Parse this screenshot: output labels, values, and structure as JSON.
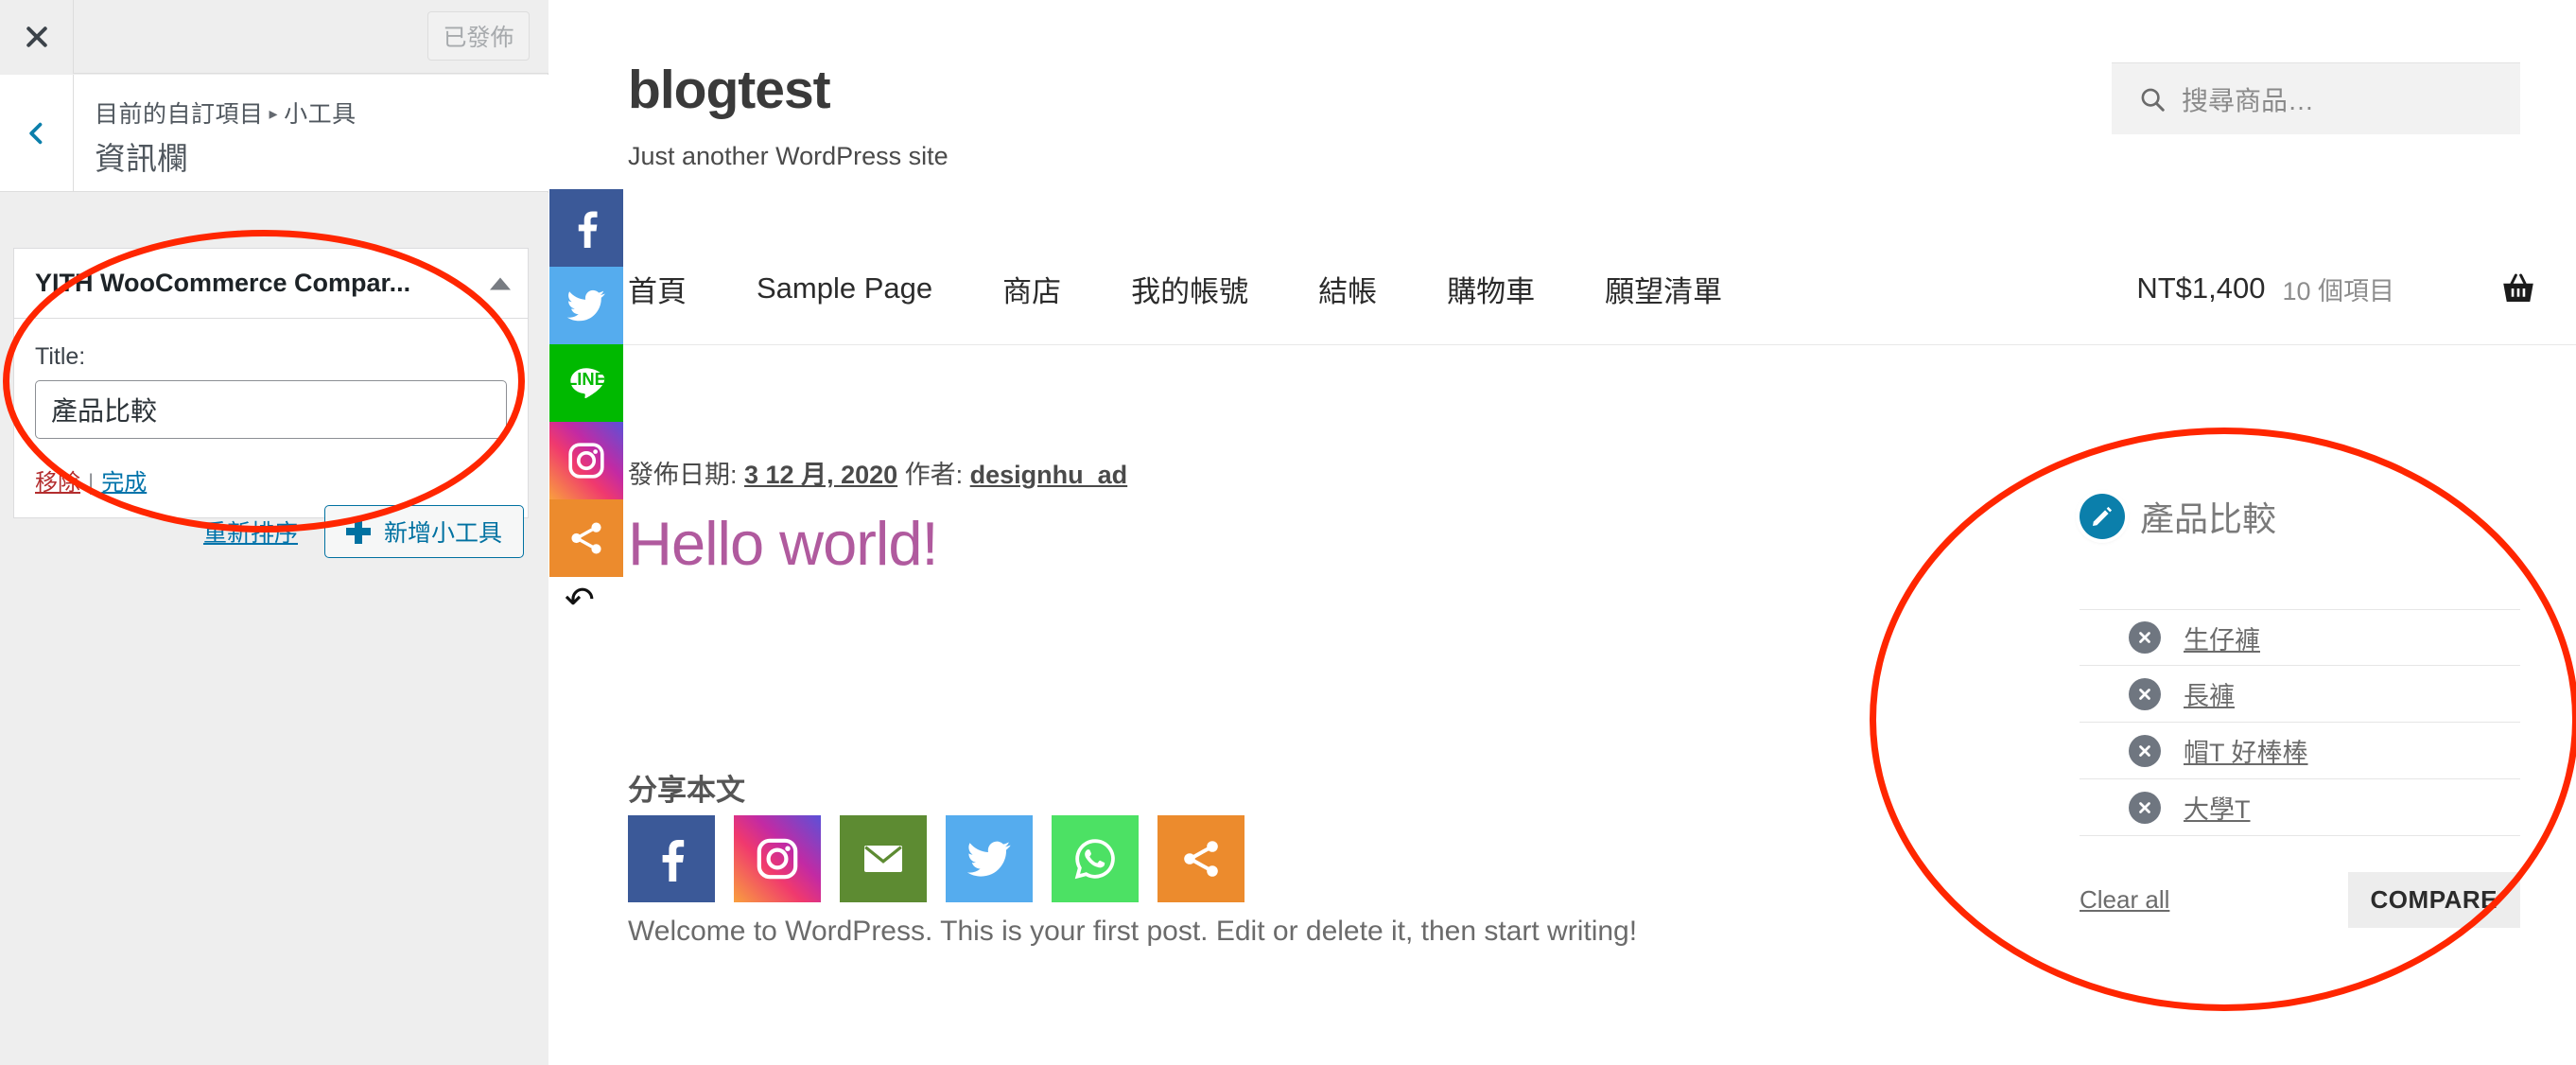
{
  "customizer": {
    "close_icon": "close-icon",
    "publish_label": "已發佈",
    "back_icon": "chevron-left-icon",
    "breadcrumb_parent": "目前的自訂項目",
    "breadcrumb_sep": "▸",
    "breadcrumb_current": "小工具",
    "panel_title": "資訊欄",
    "widget": {
      "name": "YITH WooCommerce Compar...",
      "toggle_icon": "chevron-up-icon",
      "field_label": "Title:",
      "field_value": "產品比較",
      "field_placeholder": "",
      "delete_label": "移除",
      "separator": "|",
      "done_label": "完成"
    },
    "reorder_label": "重新排序",
    "add_widget_label": "新增小工具",
    "add_widget_icon": "plus-icon"
  },
  "site": {
    "title": "blogtest",
    "tagline": "Just another WordPress site",
    "search": {
      "icon": "search-icon",
      "placeholder": "搜尋商品…",
      "value": ""
    },
    "nav": [
      {
        "label": "首頁"
      },
      {
        "label": "Sample Page"
      },
      {
        "label": "商店"
      },
      {
        "label": "我的帳號"
      },
      {
        "label": "結帳"
      },
      {
        "label": "購物車"
      },
      {
        "label": "願望清單"
      }
    ],
    "cart": {
      "total": "NT$1,400",
      "count": "10 個項目",
      "icon": "basket-icon"
    },
    "social_rail": [
      {
        "name": "facebook-icon",
        "color": "#3b5998"
      },
      {
        "name": "twitter-icon",
        "color": "#55acee"
      },
      {
        "name": "line-icon",
        "color": "#00b900",
        "text": "LINE"
      },
      {
        "name": "instagram-icon",
        "color": "#c32aa3"
      },
      {
        "name": "share-icon",
        "color": "#ec8b2d"
      }
    ],
    "rail_arrow_icon": "arrow-turn-left-icon"
  },
  "post": {
    "meta_prefix": "發佈日期: ",
    "date": "3 12 月, 2020",
    "author_prefix": " 作者: ",
    "author": "designhu_ad",
    "title": "Hello world!",
    "share_heading": "分享本文",
    "share_buttons": [
      {
        "name": "facebook-icon",
        "color": "#3b5998"
      },
      {
        "name": "instagram-icon",
        "color": "#c32aa3"
      },
      {
        "name": "email-icon",
        "color": "#5d8b32"
      },
      {
        "name": "twitter-icon",
        "color": "#55acee"
      },
      {
        "name": "whatsapp-icon",
        "color": "#4ce164"
      },
      {
        "name": "share-icon",
        "color": "#ec8b2d"
      }
    ],
    "body": "Welcome to WordPress. This is your first post. Edit or delete it, then start writing!"
  },
  "compare_widget": {
    "edit_icon": "pencil-icon",
    "title": "產品比較",
    "items": [
      {
        "label": "生仔褲",
        "remove_icon": "remove-circle-icon"
      },
      {
        "label": "長褲",
        "remove_icon": "remove-circle-icon"
      },
      {
        "label": "帽T 好棒棒",
        "remove_icon": "remove-circle-icon"
      },
      {
        "label": "大學T",
        "remove_icon": "remove-circle-icon"
      }
    ],
    "clear_all_label": "Clear all",
    "compare_label": "COMPARE"
  },
  "annotations": {
    "color": "#ff2600",
    "shapes": [
      {
        "name": "annotation-ellipse-widget-panel"
      },
      {
        "name": "annotation-ellipse-compare-widget"
      }
    ]
  }
}
